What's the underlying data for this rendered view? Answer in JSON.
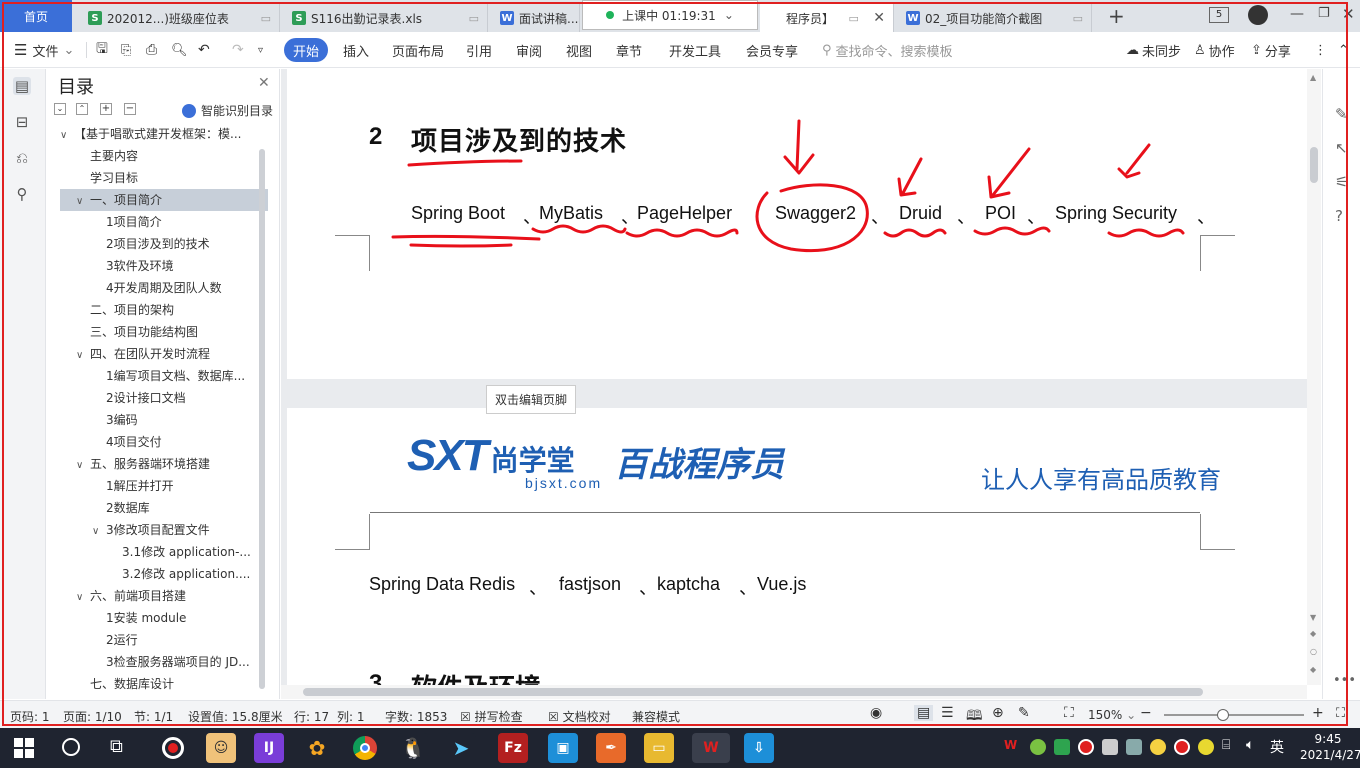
{
  "tabs": [
    {
      "label": "首页",
      "kind": "home"
    },
    {
      "label": "202012...)班级座位表",
      "kind": "sheet"
    },
    {
      "label": "S116出勤记录表.xls",
      "kind": "sheet"
    },
    {
      "label": "面试讲稿...程",
      "kind": "word"
    },
    {
      "label": "程序员】",
      "kind": "word"
    },
    {
      "label": "02_项目功能简介截图",
      "kind": "word"
    }
  ],
  "live": {
    "label": "上课中 01:19:31"
  },
  "window": {
    "page_count": "5"
  },
  "menu": {
    "file": "文件",
    "start": "开始",
    "items": [
      "插入",
      "页面布局",
      "引用",
      "审阅",
      "视图",
      "章节",
      "开发工具",
      "会员专享"
    ],
    "search_placeholder": "查找命令、搜索模板",
    "sync": "未同步",
    "collab": "协作",
    "share": "分享"
  },
  "toc": {
    "title": "目录",
    "smart": "智能识别目录",
    "items": [
      {
        "label": "【基于唱歌式建开发框架：模...",
        "arrow": "∨",
        "indent": 0
      },
      {
        "label": "主要内容",
        "arrow": "",
        "indent": 1
      },
      {
        "label": "学习目标",
        "arrow": "",
        "indent": 1
      },
      {
        "label": "一、项目简介",
        "arrow": "∨",
        "indent": 1,
        "selected": true
      },
      {
        "label": "1项目简介",
        "arrow": "",
        "indent": 2
      },
      {
        "label": "2项目涉及到的技术",
        "arrow": "",
        "indent": 2
      },
      {
        "label": "3软件及环境",
        "arrow": "",
        "indent": 2
      },
      {
        "label": "4开发周期及团队人数",
        "arrow": "",
        "indent": 2
      },
      {
        "label": "二、项目的架构",
        "arrow": "",
        "indent": 1
      },
      {
        "label": "三、项目功能结构图",
        "arrow": "",
        "indent": 1
      },
      {
        "label": "四、在团队开发时流程",
        "arrow": "∨",
        "indent": 1
      },
      {
        "label": "1编写项目文档、数据库...",
        "arrow": "",
        "indent": 2
      },
      {
        "label": "2设计接口文档",
        "arrow": "",
        "indent": 2
      },
      {
        "label": "3编码",
        "arrow": "",
        "indent": 2
      },
      {
        "label": "4项目交付",
        "arrow": "",
        "indent": 2
      },
      {
        "label": "五、服务器端环境搭建",
        "arrow": "∨",
        "indent": 1
      },
      {
        "label": "1解压并打开",
        "arrow": "",
        "indent": 2
      },
      {
        "label": "2数据库",
        "arrow": "",
        "indent": 2
      },
      {
        "label": "3修改项目配置文件",
        "arrow": "∨",
        "indent": 2
      },
      {
        "label": "3.1修改 application-...",
        "arrow": "",
        "indent": 3
      },
      {
        "label": "3.2修改 application....",
        "arrow": "",
        "indent": 3
      },
      {
        "label": "六、前端项目搭建",
        "arrow": "∨",
        "indent": 1
      },
      {
        "label": "1安装 module",
        "arrow": "",
        "indent": 2
      },
      {
        "label": "2运行",
        "arrow": "",
        "indent": 2
      },
      {
        "label": "3检查服务器端项目的 JD...",
        "arrow": "",
        "indent": 2
      },
      {
        "label": "七、数据库设计",
        "arrow": "",
        "indent": 1
      }
    ]
  },
  "doc": {
    "heading_num": "2",
    "heading": "项目涉及到的技术",
    "tech_line1": [
      "Spring Boot",
      "、",
      "MyBatis",
      "、",
      "PageHelper",
      "Swagger2",
      "、",
      "Druid",
      "、",
      "POI",
      "、",
      "Spring Security",
      "、"
    ],
    "footer_hint": "双击编辑页脚",
    "logo_sxt": "SXT",
    "logo_cn": "尚学堂",
    "logo_url": "bjsxt.com",
    "logo_brand": "百战程序员",
    "slogan": "让人人享有高品质教育",
    "tech_line2": [
      "Spring Data Redis",
      "、",
      "fastjson",
      "、",
      "kaptcha",
      "、",
      "Vue.js"
    ],
    "next_heading_num": "3",
    "next_heading": "软件及环境"
  },
  "status": {
    "page": "页码: 1",
    "pages": "页面: 1/10",
    "section": "节: 1/1",
    "setting": "设置值: 15.8厘米",
    "row": "行: 17",
    "col": "列: 1",
    "words": "字数: 1853",
    "spell": "拼写检查",
    "proof": "文档校对",
    "compat": "兼容模式",
    "zoom": "150%",
    "zoom_level": 0.42
  },
  "clock": {
    "time": "9:45",
    "date": "2021/4/27"
  },
  "ime": "英",
  "colors": {
    "accent": "#3b6fd8",
    "annotation": "#e8101a",
    "logo_blue": "#1e5fb3"
  }
}
